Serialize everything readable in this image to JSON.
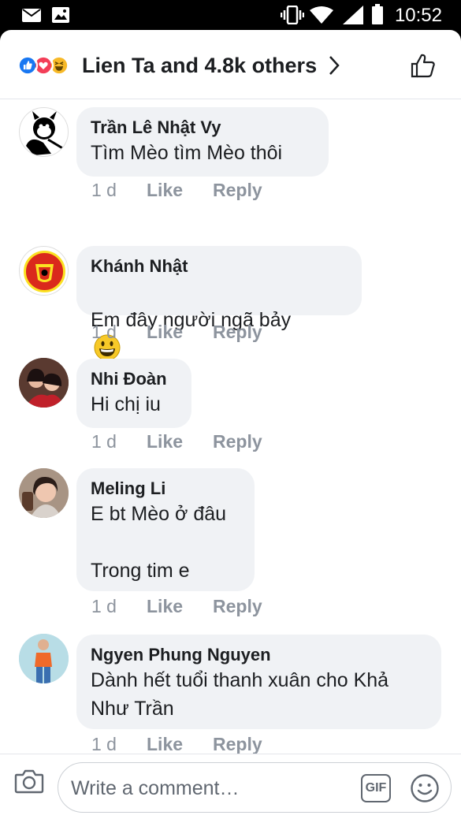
{
  "status_bar": {
    "time": "10:52",
    "icons": [
      "mail-icon",
      "image-icon",
      "vibrate-icon",
      "wifi-icon",
      "signal-icon",
      "battery-icon"
    ]
  },
  "reactions": {
    "icons": [
      "like-reaction-icon",
      "love-reaction-icon",
      "haha-reaction-icon"
    ],
    "summary": "Lien Ta and 4.8k others"
  },
  "comments": [
    {
      "author": "Trần Lê Nhật Vy",
      "text": "Tìm Mèo tìm Mèo thôi",
      "age": "1 d",
      "like_label": "Like",
      "reply_label": "Reply"
    },
    {
      "author": "Khánh Nhật",
      "text": "Em đây người ngã bảy",
      "emoji": "😀",
      "age": "1 d",
      "like_label": "Like",
      "reply_label": "Reply"
    },
    {
      "author": "Nhi Đoàn",
      "text": "Hi chị iu",
      "age": "1 d",
      "like_label": "Like",
      "reply_label": "Reply"
    },
    {
      "author": "Meling Li",
      "text": "E bt Mèo ở đâu\n\nTrong tim e",
      "age": "1 d",
      "like_label": "Like",
      "reply_label": "Reply"
    },
    {
      "author": "Ngyen Phung Nguyen",
      "text": "Dành hết tuổi thanh xuân cho Khả\nNhư Trần",
      "age": "1 d",
      "like_label": "Like",
      "reply_label": "Reply"
    }
  ],
  "composer": {
    "placeholder": "Write a comment…",
    "gif_label": "GIF"
  },
  "colors": {
    "like_blue": "#1877f2",
    "love_red": "#f33e58",
    "haha_yellow": "#f7b928",
    "bubble_bg": "#f0f2f5",
    "meta_gray": "#8d949e"
  }
}
